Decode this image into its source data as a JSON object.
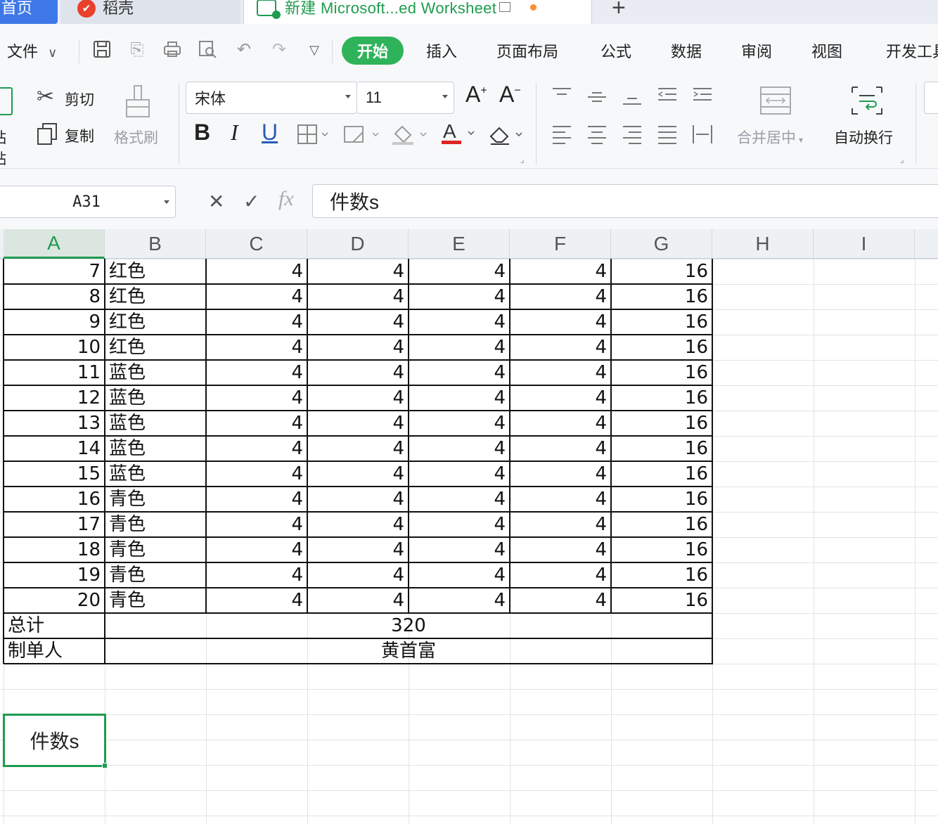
{
  "tabs": {
    "home": "首页",
    "docer": "稻壳",
    "document": "新建 Microsoft...ed Worksheet",
    "add": "+"
  },
  "menu": {
    "file": "文件",
    "start": "开始",
    "insert": "插入",
    "page_layout": "页面布局",
    "formula": "公式",
    "data": "数据",
    "review": "审阅",
    "view": "视图",
    "developer": "开发工具"
  },
  "ribbon": {
    "paste": "粘贴",
    "cut": "剪切",
    "copy": "复制",
    "format_painter": "格式刷",
    "font_name": "宋体",
    "font_size": "11",
    "bold": "B",
    "italic": "I",
    "underline": "U",
    "merge_center": "合并居中",
    "wrap_text": "自动换行"
  },
  "formula_bar": {
    "name_box": "A31",
    "fx": "fx",
    "content": "件数s"
  },
  "columns": [
    "A",
    "B",
    "C",
    "D",
    "E",
    "F",
    "G",
    "H",
    "I"
  ],
  "rows": [
    {
      "a": "7",
      "b": "红色",
      "c": "4",
      "d": "4",
      "e": "4",
      "f": "4",
      "g": "16"
    },
    {
      "a": "8",
      "b": "红色",
      "c": "4",
      "d": "4",
      "e": "4",
      "f": "4",
      "g": "16"
    },
    {
      "a": "9",
      "b": "红色",
      "c": "4",
      "d": "4",
      "e": "4",
      "f": "4",
      "g": "16"
    },
    {
      "a": "10",
      "b": "红色",
      "c": "4",
      "d": "4",
      "e": "4",
      "f": "4",
      "g": "16"
    },
    {
      "a": "11",
      "b": "蓝色",
      "c": "4",
      "d": "4",
      "e": "4",
      "f": "4",
      "g": "16"
    },
    {
      "a": "12",
      "b": "蓝色",
      "c": "4",
      "d": "4",
      "e": "4",
      "f": "4",
      "g": "16"
    },
    {
      "a": "13",
      "b": "蓝色",
      "c": "4",
      "d": "4",
      "e": "4",
      "f": "4",
      "g": "16"
    },
    {
      "a": "14",
      "b": "蓝色",
      "c": "4",
      "d": "4",
      "e": "4",
      "f": "4",
      "g": "16"
    },
    {
      "a": "15",
      "b": "蓝色",
      "c": "4",
      "d": "4",
      "e": "4",
      "f": "4",
      "g": "16"
    },
    {
      "a": "16",
      "b": "青色",
      "c": "4",
      "d": "4",
      "e": "4",
      "f": "4",
      "g": "16"
    },
    {
      "a": "17",
      "b": "青色",
      "c": "4",
      "d": "4",
      "e": "4",
      "f": "4",
      "g": "16"
    },
    {
      "a": "18",
      "b": "青色",
      "c": "4",
      "d": "4",
      "e": "4",
      "f": "4",
      "g": "16"
    },
    {
      "a": "19",
      "b": "青色",
      "c": "4",
      "d": "4",
      "e": "4",
      "f": "4",
      "g": "16"
    },
    {
      "a": "20",
      "b": "青色",
      "c": "4",
      "d": "4",
      "e": "4",
      "f": "4",
      "g": "16"
    }
  ],
  "total": {
    "label": "总计",
    "value": "320"
  },
  "maker": {
    "label": "制单人",
    "value": "黄首富"
  },
  "active_cell_value": "件数s",
  "colors": {
    "accent_green": "#1f9c4f",
    "start_button": "#2fb35a",
    "home_tab": "#3e78e8"
  }
}
